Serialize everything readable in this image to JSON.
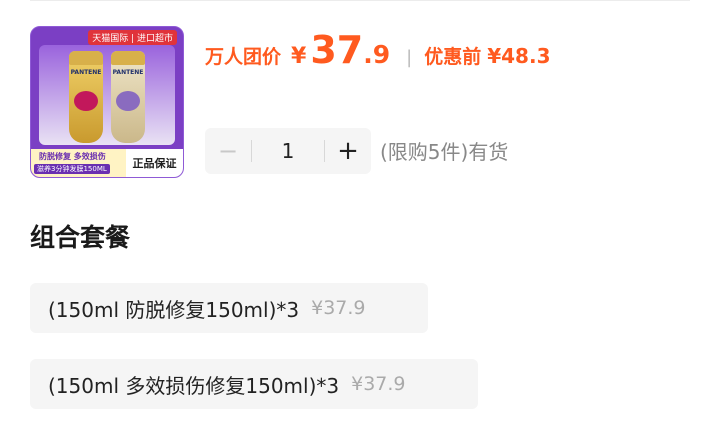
{
  "thumbnail": {
    "mall_badge": "天猫国际 | 进口超市",
    "brand": "PANTENE",
    "footer_line1": "防脱修复 多效损伤",
    "footer_line2": "滋养3分钟发膜150ML",
    "footer_right": "正品保证"
  },
  "price": {
    "label": "万人团价",
    "currency": "¥",
    "integer": "37",
    "decimal": ".9",
    "separator": "|",
    "before_label": "优惠前",
    "before_value": "¥48.3",
    "accent_color": "#ff5a1f"
  },
  "stepper": {
    "minus": "−",
    "quantity": "1",
    "plus": "+"
  },
  "stock_text": "(限购5件)有货",
  "bundles": {
    "title": "组合套餐",
    "items": [
      {
        "name": "(150ml 防脱修复150ml)*3",
        "price": "¥37.9"
      },
      {
        "name": "(150ml 多效损伤修复150ml)*3",
        "price": "¥37.9"
      }
    ]
  }
}
